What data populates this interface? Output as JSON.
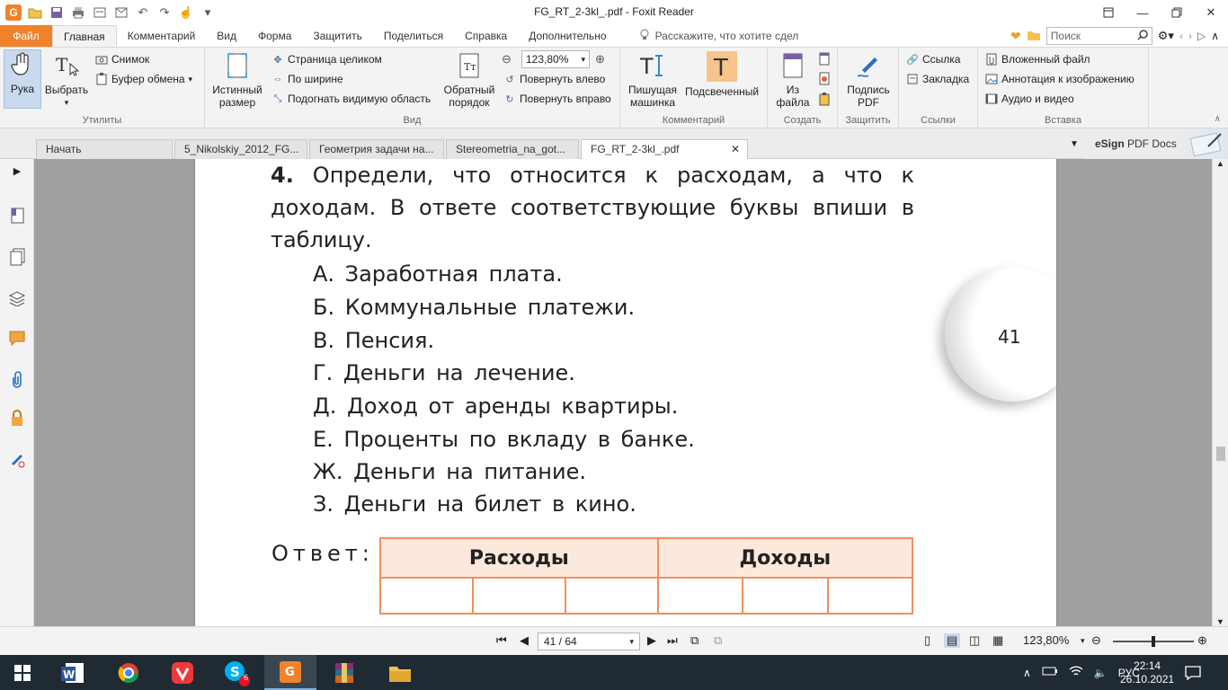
{
  "window": {
    "title": "FG_RT_2-3kl_.pdf - Foxit Reader"
  },
  "menu": {
    "file": "Файл",
    "items": [
      "Главная",
      "Комментарий",
      "Вид",
      "Форма",
      "Защитить",
      "Поделиться",
      "Справка",
      "Дополнительно"
    ],
    "tell_me": "Расскажите, что хотите сдел",
    "search_placeholder": "Поиск"
  },
  "ribbon": {
    "hand": "Рука",
    "select": "Выбрать",
    "snapshot": "Снимок",
    "clipboard": "Буфер обмена",
    "utilities_label": "Утилиты",
    "actual_size_1": "Истинный",
    "actual_size_2": "размер",
    "fit_page": "Страница целиком",
    "fit_width": "По ширине",
    "fit_visible": "Подогнать видимую область",
    "reverse_1": "Обратный",
    "reverse_2": "порядок",
    "zoom_value": "123,80%",
    "rotate_left": "Повернуть влево",
    "rotate_right": "Повернуть вправо",
    "view_label": "Вид",
    "typewriter_1": "Пишущая",
    "typewriter_2": "машинка",
    "highlight": "Подсвеченный",
    "comment_label": "Комментарий",
    "from_file_1": "Из",
    "from_file_2": "файла",
    "create_label": "Создать",
    "sign_1": "Подпись",
    "sign_2": "PDF",
    "protect_label": "Защитить",
    "link": "Ссылка",
    "bookmark": "Закладка",
    "links_label": "Ссылки",
    "attach_file": "Вложенный файл",
    "image_annotation": "Аннотация к изображению",
    "audio_video": "Аудио и видео",
    "insert_label": "Вставка"
  },
  "tabs": [
    {
      "label": "Начать"
    },
    {
      "label": "5_Nikolskiy_2012_FG..."
    },
    {
      "label": "Геометрия задачи на..."
    },
    {
      "label": "Stereometria_na_got..."
    },
    {
      "label": "FG_RT_2-3kl_.pdf"
    }
  ],
  "esign": {
    "brand": "eSign",
    "label": "PDF Docs"
  },
  "document": {
    "task_number": "4.",
    "task_text": " Определи, что относится к расходам, а что к доходам. В ответе соответствующие буквы впиши в таблицу.",
    "options": [
      "А. Заработная плата.",
      "Б. Коммунальные платежи.",
      "В. Пенсия.",
      "Г. Деньги на лечение.",
      "Д. Доход от аренды квартиры.",
      "Е. Проценты по вкладу в банке.",
      "Ж. Деньги на питание.",
      "З. Деньги на билет в кино."
    ],
    "answer_label": "Ответ:",
    "table_headers": [
      "Расходы",
      "Доходы"
    ],
    "page_number": "41"
  },
  "statusbar": {
    "page_indicator": "41 / 64",
    "zoom": "123,80%"
  },
  "taskbar": {
    "skype_badge": "6",
    "lang": "РУС",
    "time": "22:14",
    "date": "26.10.2021"
  }
}
